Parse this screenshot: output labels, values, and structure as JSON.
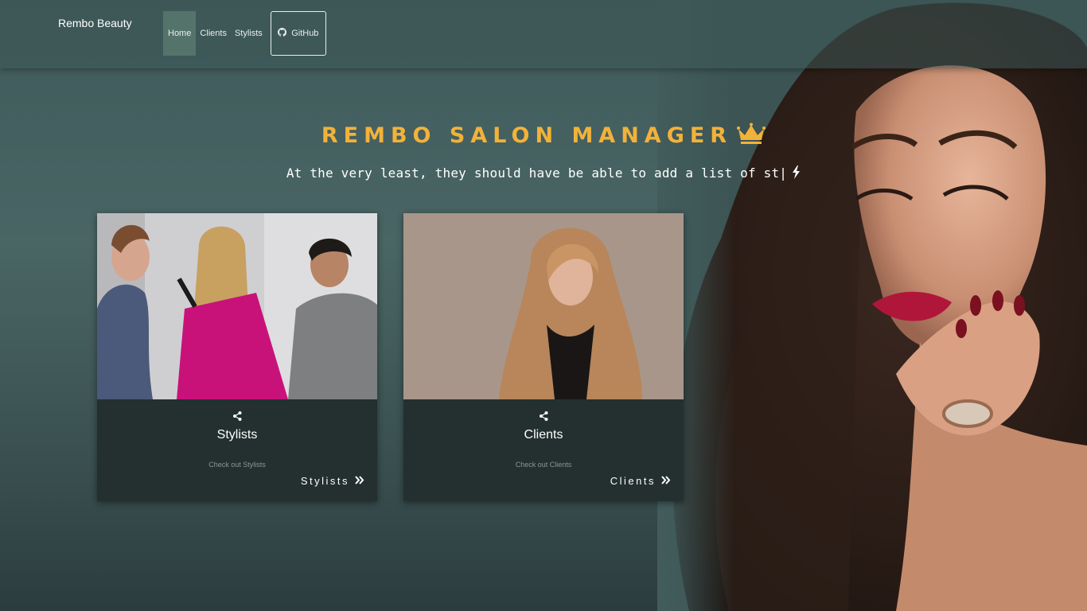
{
  "navbar": {
    "brand": "Rembo Beauty",
    "links": [
      "Home",
      "Clients",
      "Stylists"
    ],
    "github_label": "GitHub",
    "active": "Home"
  },
  "hero": {
    "title": "REMBO SALON MANAGER",
    "typed_text": "At the very least, they should have be able to add a list of st|",
    "title_color": "#f2b23a",
    "icons": [
      "crown-icon",
      "bolt-icon"
    ]
  },
  "cards": [
    {
      "title": "Stylists",
      "subtitle": "Check out Stylists",
      "link_label": "Stylists",
      "icons": [
        "share-icon",
        "double-chevron-right-icon"
      ]
    },
    {
      "title": "Clients",
      "subtitle": "Check out Clients",
      "link_label": "Clients",
      "icons": [
        "share-icon",
        "double-chevron-right-icon"
      ]
    }
  ]
}
